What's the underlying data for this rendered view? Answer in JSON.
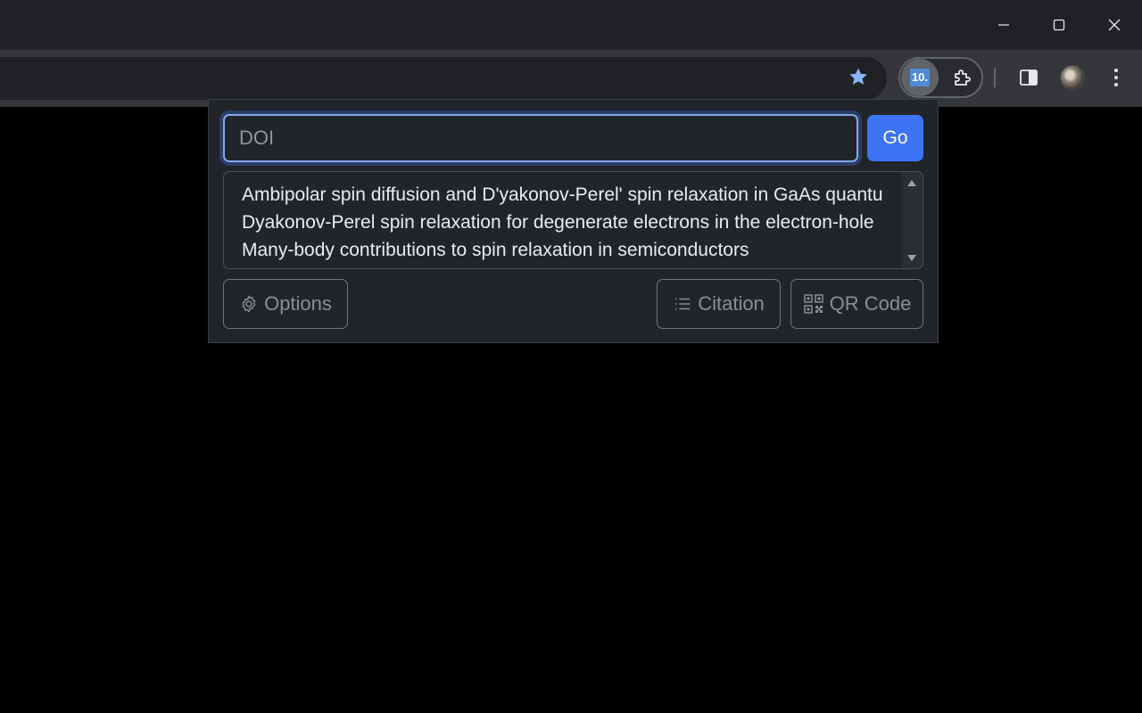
{
  "window": {
    "controls": [
      "minimize-icon",
      "maximize-icon",
      "close-icon"
    ]
  },
  "toolbar": {
    "extension_badge": "10.",
    "icons": [
      "star-icon",
      "puzzle-icon",
      "side-panel-icon",
      "kebab-menu-icon"
    ],
    "star_color": "#8ab4f8"
  },
  "popup": {
    "doi_placeholder": "DOI",
    "doi_value": "",
    "go_label": "Go",
    "results": [
      "Ambipolar spin diffusion and D'yakonov-Perel' spin relaxation in GaAs quantu",
      "Dyakonov-Perel spin relaxation for degenerate electrons in the electron-hole",
      "Many-body contributions to spin relaxation in semiconductors"
    ],
    "options_label": "Options",
    "citation_label": "Citation",
    "qr_label": "QR Code",
    "accent_color": "#3d73f5"
  }
}
